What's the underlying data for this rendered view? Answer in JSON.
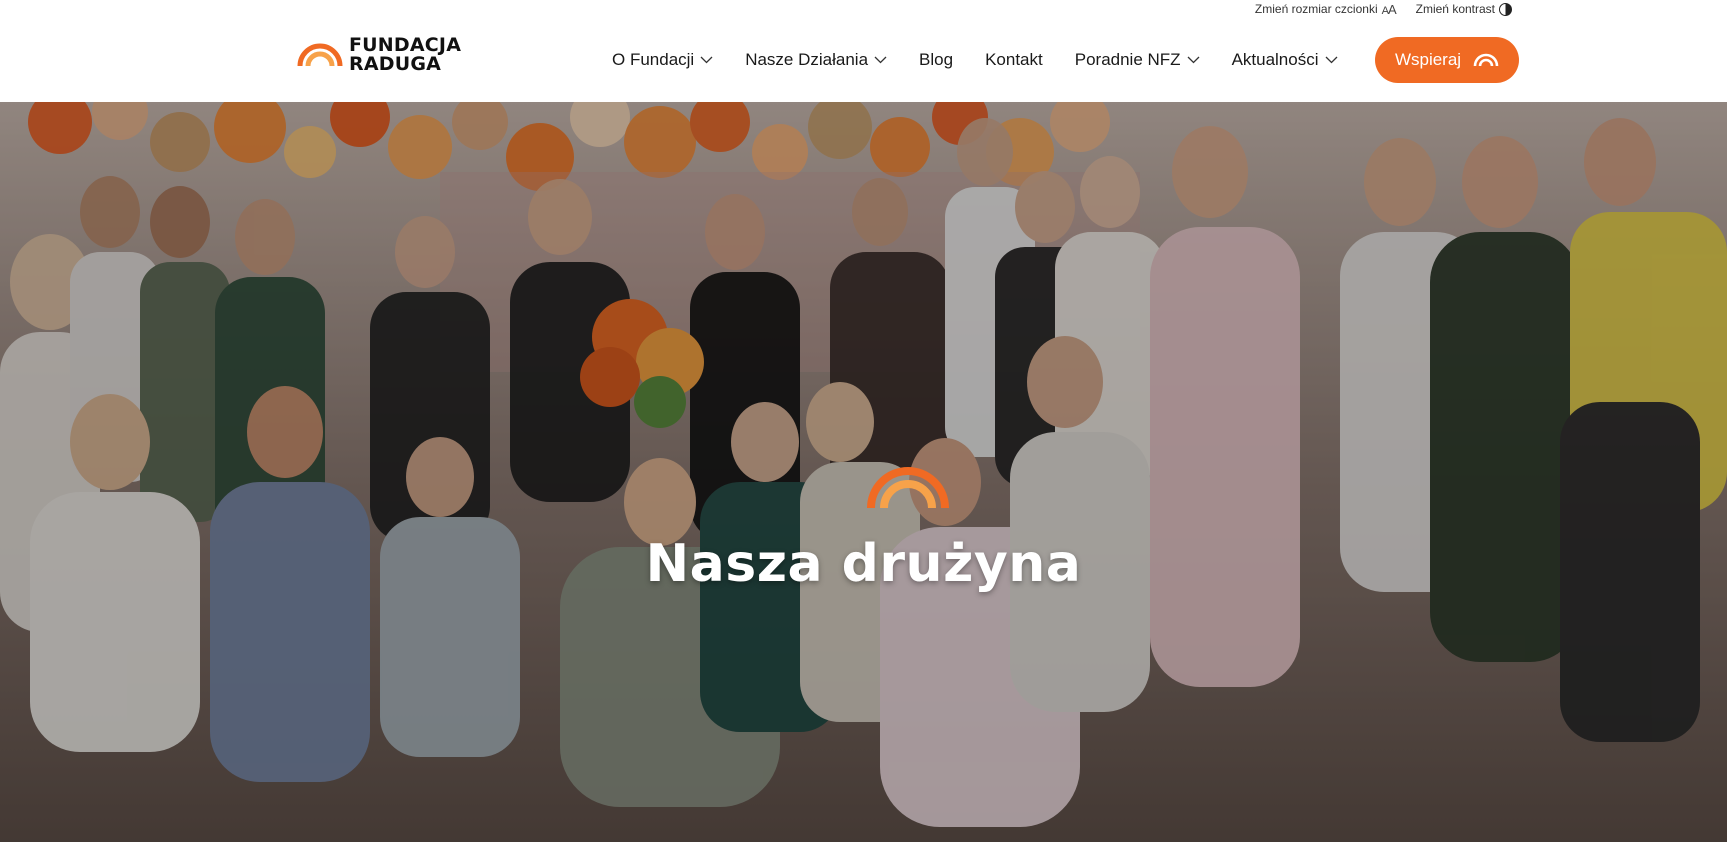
{
  "a11y": {
    "font_size_label": "Zmień rozmiar czcionki",
    "font_size_icon_small": "A",
    "font_size_icon_big": "A",
    "contrast_label": "Zmień kontrast"
  },
  "logo": {
    "line1": "FUNDACJA",
    "line2": "RADUGA"
  },
  "nav": {
    "items": [
      {
        "label": "O Fundacji",
        "has_dropdown": true
      },
      {
        "label": "Nasze Działania",
        "has_dropdown": true
      },
      {
        "label": "Blog",
        "has_dropdown": false
      },
      {
        "label": "Kontakt",
        "has_dropdown": false
      },
      {
        "label": "Poradnie NFZ",
        "has_dropdown": true
      },
      {
        "label": "Aktualności",
        "has_dropdown": true
      }
    ]
  },
  "support_button": {
    "label": "Wspieraj"
  },
  "hero": {
    "title": "Nasza drużyna"
  },
  "colors": {
    "accent": "#f06a23",
    "accent_light": "#f7a24a",
    "text": "#1a1a1a"
  },
  "icons": [
    "chevron-down-icon",
    "rainbow-logo-icon",
    "contrast-icon",
    "font-size-icon"
  ]
}
